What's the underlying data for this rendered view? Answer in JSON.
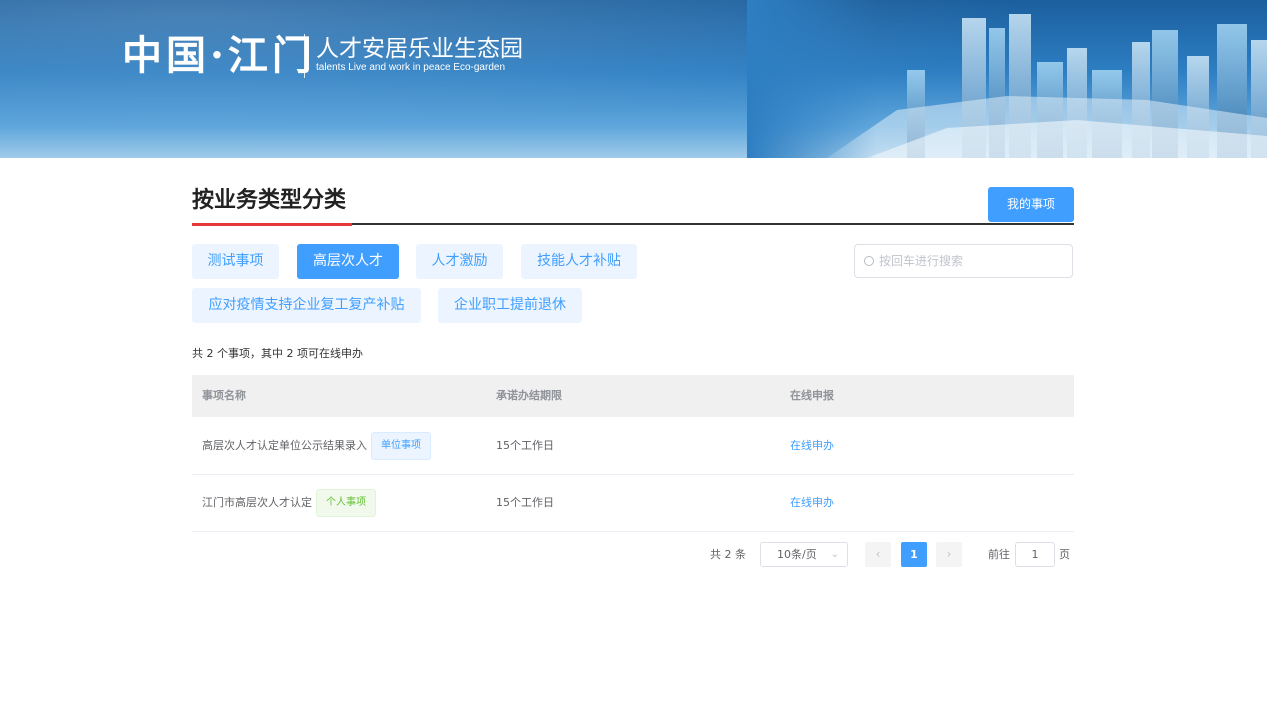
{
  "banner": {
    "logo_cn": "中国·江门",
    "title": "人才安居乐业生态园",
    "subtitle": "talents Live and work in peace Eco-garden"
  },
  "section": {
    "heading": "按业务类型分类",
    "my_items_label": "我的事项"
  },
  "categories": [
    {
      "label": "测试事项",
      "active": false
    },
    {
      "label": "高层次人才",
      "active": true
    },
    {
      "label": "人才激励",
      "active": false
    },
    {
      "label": "技能人才补贴",
      "active": false
    },
    {
      "label": "应对疫情支持企业复工复产补贴",
      "active": false
    },
    {
      "label": "企业职工提前退休",
      "active": false
    }
  ],
  "search": {
    "placeholder": "按回车进行搜索",
    "value": ""
  },
  "summary": "共 2 个事项，其中 2 项可在线申办",
  "table": {
    "headers": [
      "事项名称",
      "承诺办结期限",
      "在线申报"
    ],
    "rows": [
      {
        "name": "高层次人才认定单位公示结果录入",
        "tag": "单位事项",
        "deadline": "15个工作日",
        "action": "在线申办"
      },
      {
        "name": "江门市高层次人才认定",
        "tag": "个人事项",
        "deadline": "15个工作日",
        "action": "在线申办"
      }
    ]
  },
  "pagination": {
    "total": "共 2 条",
    "page_size": "10条/页",
    "prev": "‹",
    "next": "›",
    "current": "1",
    "goto_label": "前往",
    "goto_value": "1",
    "page_suffix": "页"
  },
  "colors": {
    "primary": "#409eff",
    "accent_red": "#e5383b",
    "tag_green": "#67c23a"
  }
}
